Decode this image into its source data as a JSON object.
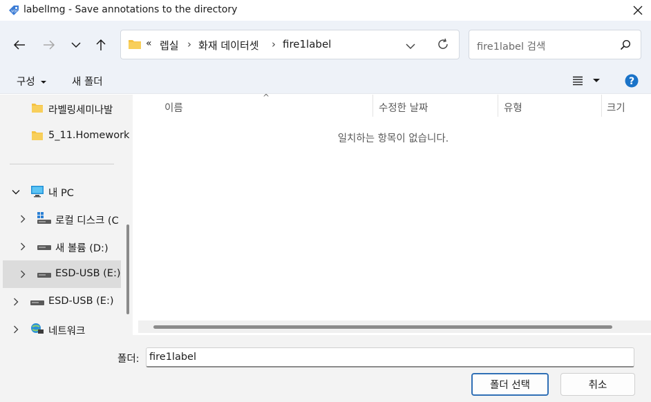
{
  "window": {
    "title": "labelImg - Save annotations to the directory",
    "app_icon": "labelimg-app-icon",
    "close_icon": "close-icon"
  },
  "nav": {
    "back_icon": "arrow-left-icon",
    "forward_icon": "arrow-right-icon",
    "recent_icon": "chevron-down-icon",
    "up_icon": "arrow-up-icon",
    "address": {
      "folder_icon": "folder-icon",
      "overflow": "«",
      "crumbs": [
        "렙실",
        "화재 데이터셋",
        "fire1label"
      ],
      "separator": "›",
      "dropdown_icon": "chevron-down-icon",
      "refresh_icon": "refresh-icon"
    },
    "search": {
      "placeholder": "fire1label 검색",
      "icon": "search-icon"
    }
  },
  "toolbar": {
    "organize_label": "구성",
    "new_folder_label": "새 폴더",
    "view_icon": "list-view-icon",
    "help_icon": "help-icon"
  },
  "navpane": {
    "items": [
      {
        "label": "라벨링세미나발",
        "icon": "folder-icon"
      },
      {
        "label": "5_11.Homework",
        "icon": "folder-icon"
      },
      {
        "label": "내 PC",
        "icon": "monitor-icon",
        "expanded": true
      },
      {
        "label": "로컬 디스크 (C",
        "icon": "windows-drive-icon"
      },
      {
        "label": "새 볼륨 (D:)",
        "icon": "drive-icon"
      },
      {
        "label": "ESD-USB (E:)",
        "icon": "drive-icon",
        "selected": true
      },
      {
        "label": "ESD-USB (E:)",
        "icon": "drive-icon"
      },
      {
        "label": "네트워크",
        "icon": "network-icon"
      }
    ]
  },
  "filelist": {
    "columns": [
      "이름",
      "수정한 날짜",
      "유형",
      "크기"
    ],
    "sort_indicator": "^",
    "empty_message": "일치하는 항목이 없습니다."
  },
  "footer": {
    "folder_label": "폴더:",
    "folder_value": "fire1label",
    "select_button": "폴더 선택",
    "cancel_button": "취소"
  },
  "colors": {
    "accent": "#2f6fb5",
    "folder": "#f5c242",
    "nav_background": "#eef2f8",
    "help": "#1a73c8"
  }
}
